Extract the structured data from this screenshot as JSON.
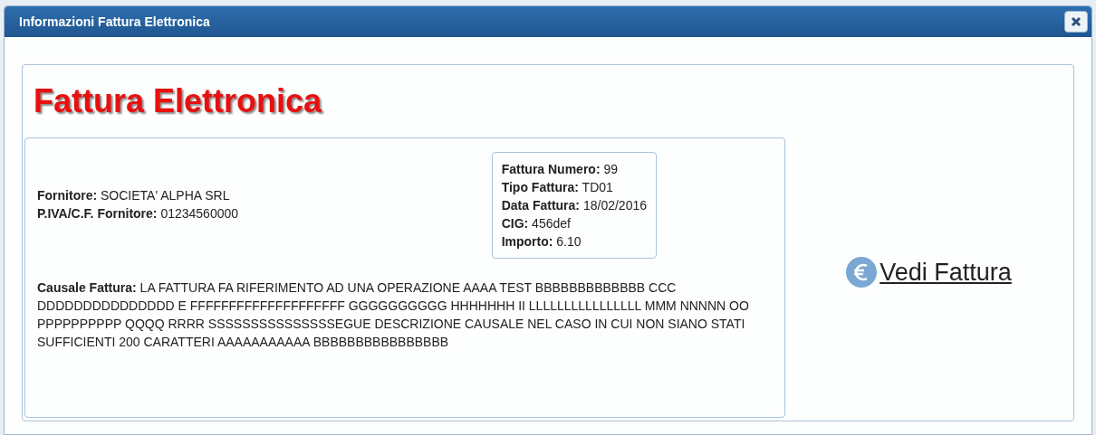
{
  "window": {
    "title": "Informazioni Fattura Elettronica"
  },
  "heading": "Fattura Elettronica",
  "supplier": [
    {
      "label": "Fornitore:",
      "value": "SOCIETA' ALPHA SRL"
    },
    {
      "label": "P.IVA/C.F. Fornitore:",
      "value": "01234560000"
    }
  ],
  "invoice_details": [
    {
      "label": "Fattura Numero:",
      "value": "99"
    },
    {
      "label": "Tipo Fattura:",
      "value": "TD01"
    },
    {
      "label": "Data Fattura:",
      "value": "18/02/2016"
    },
    {
      "label": "CIG:",
      "value": "456def"
    },
    {
      "label": "Importo:",
      "value": "6.10"
    }
  ],
  "causale": {
    "label": "Causale Fattura:",
    "value": "LA FATTURA FA RIFERIMENTO AD UNA OPERAZIONE AAAA TEST BBBBBBBBBBBBB CCC DDDDDDDDDDDDDDD E FFFFFFFFFFFFFFFFFFFF GGGGGGGGGG HHHHHHH II LLLLLLLLLLLLLLLL MMM NNNNN OO PPPPPPPPPP QQQQ RRRR SSSSSSSSSSSSSSSEGUE DESCRIZIONE CAUSALE NEL CASO IN CUI NON SIANO STATI SUFFICIENTI 200 CARATTERI AAAAAAAAAAA BBBBBBBBBBBBBBBB"
  },
  "view_link": "Vedi Fattura"
}
